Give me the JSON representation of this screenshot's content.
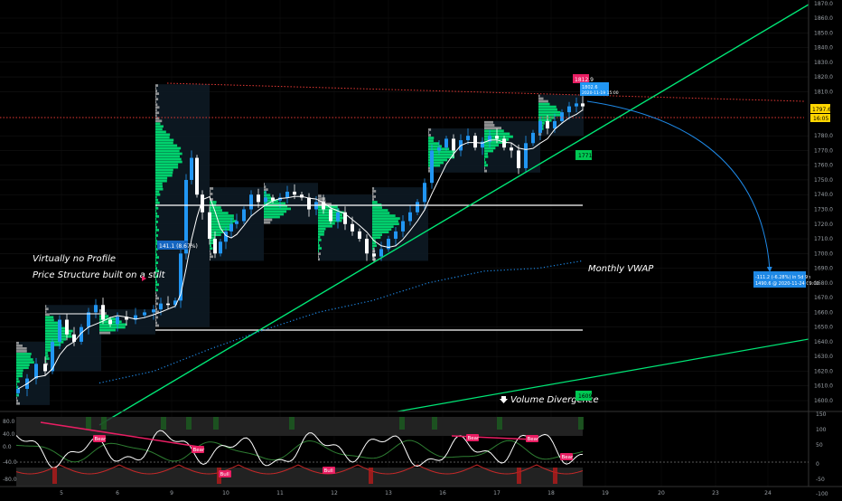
{
  "annotations": {
    "no_profile": "Virtually no Profile",
    "stilt": "Price Structure built on a stilt",
    "monthly_vwap": "Monthly VWAP",
    "volume_divergence": "Volume Divergence",
    "projection_line1": "-111.2 (-6.28%) in 5d 9h",
    "projection_line2": "1490.6 @ 2020-11-24 09:00",
    "range_box_label": "141.1 (8.67%)"
  },
  "price_tags": {
    "red_tag": "1812.9",
    "blue_tag_top": "1802.6",
    "blue_tag_bottom": "2020-11-19 15:00",
    "current_price": "1797.6",
    "current_sub": "16:05",
    "green_tag_mid": "1771",
    "green_tag_low": "1609"
  },
  "main_axis": {
    "ticks": [
      "1860.0",
      "1850.0",
      "1840.0",
      "1830.0",
      "1820.0",
      "1810.0",
      "1780.0",
      "1770.0",
      "1760.0",
      "1750.0",
      "1740.0",
      "1730.0",
      "1720.0",
      "1710.0",
      "1700.0",
      "1690.0",
      "1680.0",
      "1670.0",
      "1660.0",
      "1650.0",
      "1640.0",
      "1630.0",
      "1620.0",
      "1610.0",
      "1600.0"
    ],
    "top_partial": "1870.0",
    "top_partial2": "1860.0"
  },
  "osc_axis": {
    "right_ticks": [
      "150",
      "100",
      "50",
      "0",
      "-50",
      "-100"
    ],
    "left_ticks": [
      "80.0",
      "40.0",
      "0.0",
      "-40.0",
      "-80.0"
    ],
    "markers": [
      {
        "label": "Bear",
        "color": "#e91e63"
      },
      {
        "label": "Bear",
        "color": "#e91e63"
      },
      {
        "label": "Bull",
        "color": "#e91e63"
      },
      {
        "label": "Bull",
        "color": "#e91e63"
      },
      {
        "label": "Bear",
        "color": "#e91e63"
      },
      {
        "label": "Bear",
        "color": "#e91e63"
      },
      {
        "label": "Bear",
        "color": "#e91e63"
      }
    ]
  },
  "date_axis": [
    "5",
    "6",
    "9",
    "10",
    "11",
    "12",
    "13",
    "16",
    "17",
    "18",
    "19",
    "20",
    "23",
    "24"
  ],
  "chart_data": {
    "type": "candlestick",
    "title": "",
    "x": [
      "5",
      "6",
      "9",
      "10",
      "11",
      "12",
      "13",
      "16",
      "17",
      "18",
      "19",
      "20",
      "23",
      "24"
    ],
    "xlabel": "",
    "ylabel": "",
    "ylim": [
      1595,
      1865
    ],
    "close_approx": [
      {
        "x": "5",
        "y": 1620
      },
      {
        "x": "6",
        "y": 1660
      },
      {
        "x": "9",
        "y": 1665
      },
      {
        "x": "10",
        "y": 1705
      },
      {
        "x": "11",
        "y": 1735
      },
      {
        "x": "12",
        "y": 1720
      },
      {
        "x": "13",
        "y": 1730
      },
      {
        "x": "16",
        "y": 1780
      },
      {
        "x": "17",
        "y": 1775
      },
      {
        "x": "18",
        "y": 1800
      }
    ],
    "reference_levels": [
      1812.9,
      1797.6,
      1732,
      1650
    ],
    "projection": {
      "change": -111.2,
      "percent": -6.28,
      "target": 1490.6
    },
    "colors": {
      "up": "#2196f3",
      "down": "#ffffff",
      "trendline": "#00e676",
      "vwap": "#1e88e5",
      "profile": "#00e676",
      "resistance": "#e53935"
    }
  }
}
